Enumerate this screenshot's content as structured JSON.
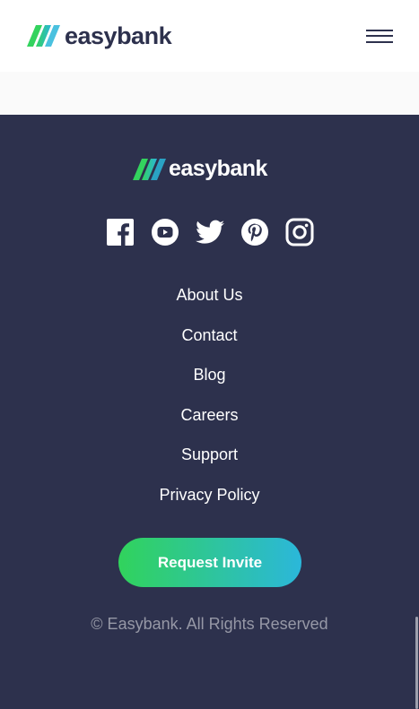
{
  "brand": {
    "name": "easybank"
  },
  "header": {
    "menu_icon": "hamburger-icon"
  },
  "footer": {
    "logo_text": "easybank",
    "socials": [
      {
        "name": "facebook",
        "icon": "facebook-icon"
      },
      {
        "name": "youtube",
        "icon": "youtube-icon"
      },
      {
        "name": "twitter",
        "icon": "twitter-icon"
      },
      {
        "name": "pinterest",
        "icon": "pinterest-icon"
      },
      {
        "name": "instagram",
        "icon": "instagram-icon"
      }
    ],
    "links": [
      "About Us",
      "Contact",
      "Blog",
      "Careers",
      "Support",
      "Privacy Policy"
    ],
    "cta_label": "Request Invite",
    "copyright": "© Easybank. All Rights Reserved"
  },
  "colors": {
    "dark_blue": "#2d314d",
    "lime_green": "#31d35c",
    "bright_cyan": "#2bb7da",
    "grayish_blue": "#9698a6",
    "white": "#ffffff"
  }
}
